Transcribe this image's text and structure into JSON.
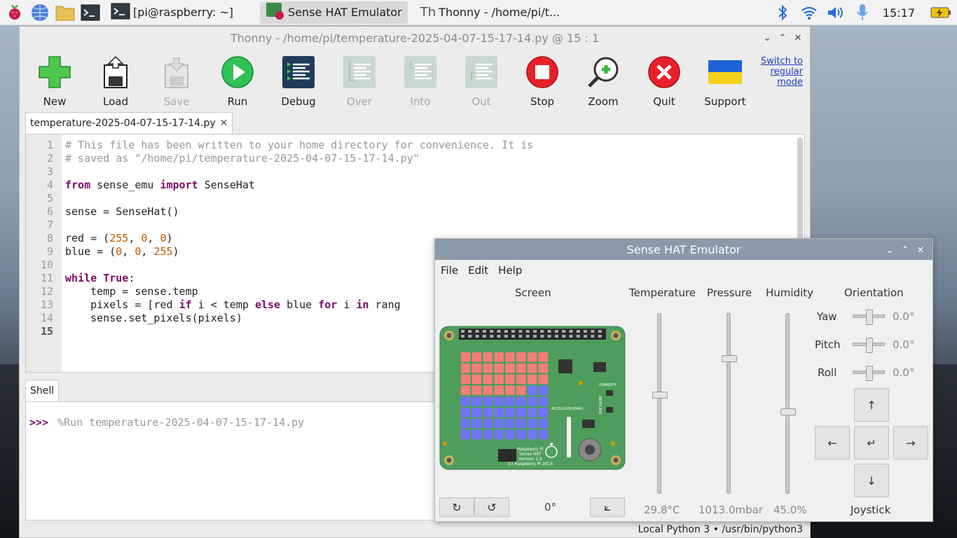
{
  "taskbar": {
    "tasks": [
      {
        "label": "[pi@raspberry: ~]"
      },
      {
        "label": "Sense HAT Emulator"
      },
      {
        "label": "Thonny  -  /home/pi/t..."
      }
    ],
    "clock": "15:17"
  },
  "thonny": {
    "title": "Thonny  -  /home/pi/temperature-2025-04-07-15-17-14.py  @  15 : 1",
    "toolbar": [
      {
        "label": "New",
        "icon": "new-icon",
        "enabled": true
      },
      {
        "label": "Load",
        "icon": "load-icon",
        "enabled": true
      },
      {
        "label": "Save",
        "icon": "save-icon",
        "enabled": false
      },
      {
        "label": "Run",
        "icon": "run-icon",
        "enabled": true
      },
      {
        "label": "Debug",
        "icon": "debug-icon",
        "enabled": true
      },
      {
        "label": "Over",
        "icon": "step-over-icon",
        "enabled": false
      },
      {
        "label": "Into",
        "icon": "step-into-icon",
        "enabled": false
      },
      {
        "label": "Out",
        "icon": "step-out-icon",
        "enabled": false
      },
      {
        "label": "Stop",
        "icon": "stop-icon",
        "enabled": true
      },
      {
        "label": "Zoom",
        "icon": "zoom-icon",
        "enabled": true
      },
      {
        "label": "Quit",
        "icon": "quit-icon",
        "enabled": true
      },
      {
        "label": "Support",
        "icon": "ukraine-flag-icon",
        "enabled": true
      }
    ],
    "switch_mode": "Switch to regular mode",
    "editor_tab": "temperature-2025-04-07-15-17-14.py",
    "line_numbers": [
      "1",
      "2",
      "3",
      "4",
      "5",
      "6",
      "7",
      "8",
      "9",
      "10",
      "11",
      "12",
      "13",
      "14",
      "15"
    ],
    "code_lines": [
      "# This file has been written to your home directory for convenience. It is",
      "# saved as \"/home/pi/temperature-2025-04-07-15-17-14.py\"",
      "",
      "from sense_emu import SenseHat",
      "",
      "sense = SenseHat()",
      "",
      "red = (255, 0, 0)",
      "blue = (0, 0, 255)",
      "",
      "while True:",
      "    temp = sense.temp",
      "    pixels = [red if i < temp else blue for i in rang",
      "    sense.set_pixels(pixels)",
      ""
    ],
    "shell_tab": "Shell",
    "shell_prompt": ">>>",
    "shell_command": "%Run temperature-2025-04-07-15-17-14.py",
    "status": "Local Python 3  •  /usr/bin/python3"
  },
  "sense_hat": {
    "title": "Sense HAT Emulator",
    "menu": [
      "File",
      "Edit",
      "Help"
    ],
    "screen_label": "Screen",
    "rotation": "0°",
    "board_text": [
      "Raspberry Pi",
      "Sense HAT",
      "Version 1.0",
      "(c) Raspberry Pi 2015"
    ],
    "board_labels": [
      "HUMIDITY",
      "ACCEL/GYRO/MAG",
      "PRESSURE"
    ],
    "led_red_count": 30,
    "temperature": {
      "label": "Temperature",
      "value": "29.8°C",
      "level": 0.55
    },
    "pressure": {
      "label": "Pressure",
      "value": "1013.0mbar",
      "level": 0.76
    },
    "humidity": {
      "label": "Humidity",
      "value": "45.0%",
      "level": 0.45
    },
    "orientation": {
      "label": "Orientation",
      "yaw": {
        "label": "Yaw",
        "value": "0.0°"
      },
      "pitch": {
        "label": "Pitch",
        "value": "0.0°"
      },
      "roll": {
        "label": "Roll",
        "value": "0.0°"
      }
    },
    "joystick": {
      "label": "Joystick",
      "up": "↑",
      "left": "←",
      "enter": "↵",
      "right": "→",
      "down": "↓"
    },
    "colors": {
      "led_red": "#f57e78",
      "led_blue": "#7274f7",
      "board": "#4f9d5c"
    }
  }
}
